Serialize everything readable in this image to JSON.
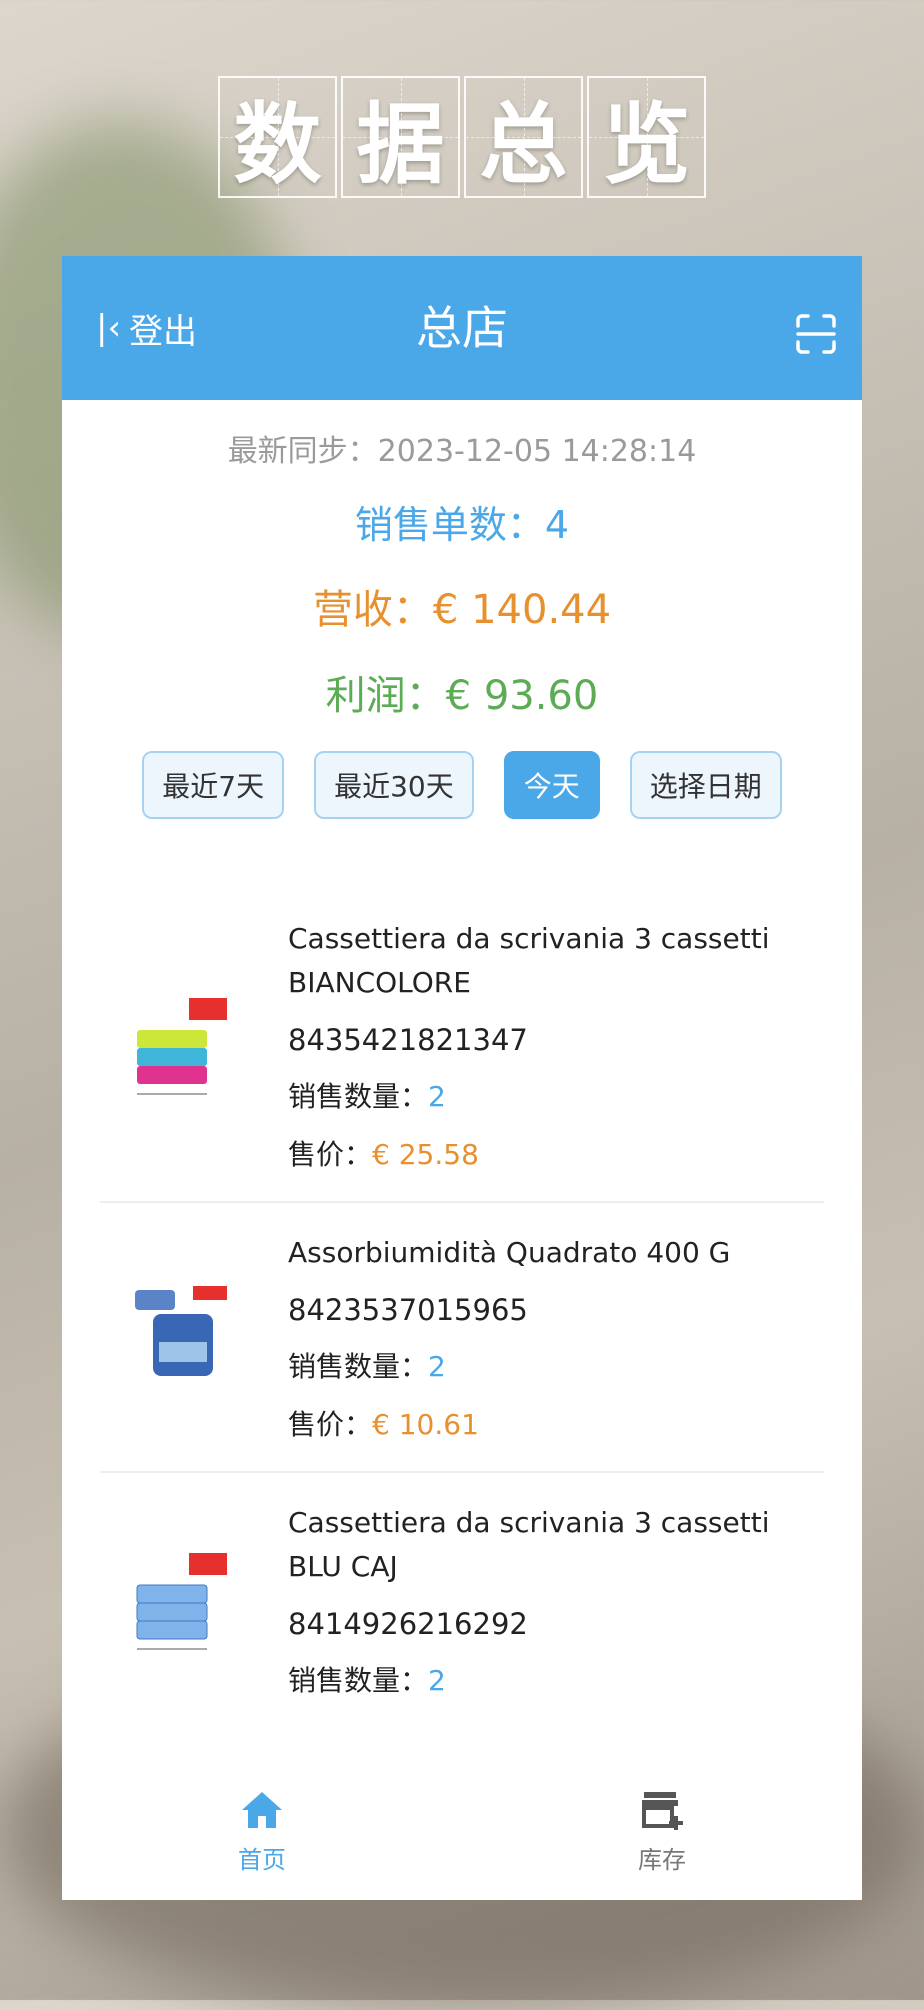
{
  "hero": {
    "chars": [
      "数",
      "据",
      "总",
      "览"
    ]
  },
  "header": {
    "logout_label": "登出",
    "title": "总店"
  },
  "stats": {
    "sync": "最新同步：2023-12-05 14:28:14",
    "orders": "销售单数：4",
    "revenue": "营收：€ 140.44",
    "profit": "利润：€ 93.60"
  },
  "filters": [
    "最近7天",
    "最近30天",
    "今天",
    "选择日期"
  ],
  "active_filter": "今天",
  "labels": {
    "qty": "销售数量：",
    "price": "售价："
  },
  "items": [
    {
      "name": "Cassettiera da scrivania 3 cassetti BIANCOLORE",
      "code": "8435421821347",
      "qty": "2",
      "price": "€ 25.58"
    },
    {
      "name": "Assorbiumidità Quadrato 400 G",
      "code": "8423537015965",
      "qty": "2",
      "price": "€ 10.61"
    },
    {
      "name": "Cassettiera da scrivania 3 cassetti BLU CAJ",
      "code": "8414926216292",
      "qty": "2",
      "price": ""
    }
  ],
  "tabs": [
    {
      "label": "首页"
    },
    {
      "label": "库存"
    }
  ],
  "colors": {
    "primary": "#4aa7e8",
    "orange": "#e88f2e",
    "green": "#5cab55"
  }
}
